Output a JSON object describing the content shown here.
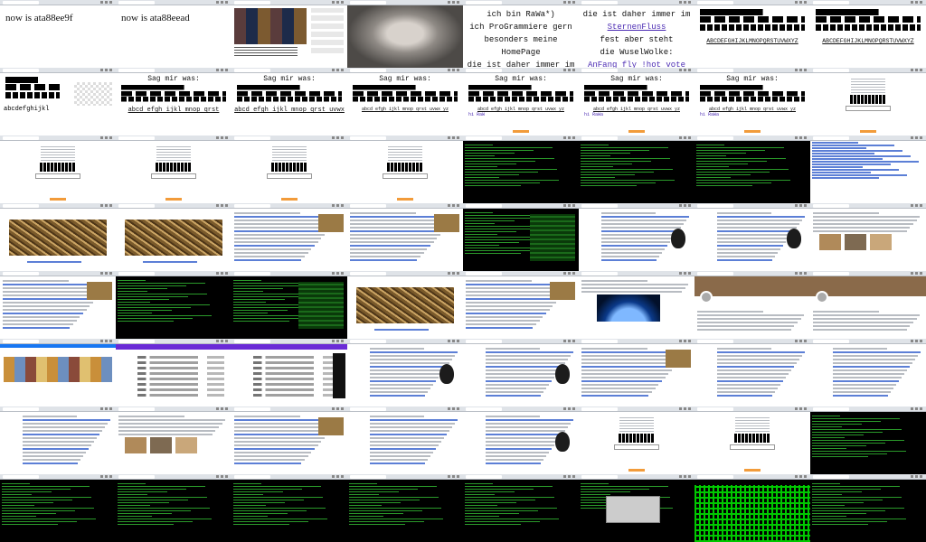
{
  "tiles": [
    {
      "kind": "text",
      "caption": "now is ata88ee9f"
    },
    {
      "kind": "text",
      "caption": "now is ata88eead"
    },
    {
      "kind": "video"
    },
    {
      "kind": "portrait"
    },
    {
      "kind": "poem1",
      "lines": [
        "ich bin RaWa*)",
        "ich ProGrammiere gern",
        "besonders meine HomePage",
        "die ist daher immer im"
      ]
    },
    {
      "kind": "poem2",
      "lines": [
        "die ist daher immer im",
        "SternenFluss",
        "fest aber steht",
        "die WuselWolke:",
        "AnFang fly !hot vote"
      ]
    },
    {
      "kind": "alpha",
      "alpha": "ABCDEFGHIJKLMNOPQRSTUVWXYZ"
    },
    {
      "kind": "alpha",
      "alpha": "ABCDEFGHIJKLMNOPQRSTUVWXYZ"
    },
    {
      "kind": "lower",
      "lower": "abcdefghijkl"
    },
    {
      "kind": "sag",
      "head": "Sag mir was:",
      "line": "abcd efgh ijkl mnop qrst"
    },
    {
      "kind": "sag",
      "head": "Sag mir was:",
      "line": "abcd efgh ijkl mnop qrst uvwx"
    },
    {
      "kind": "sag2",
      "head": "Sag mir was:",
      "line": "abcd efgh ijkl mnop qrst uvwx yz"
    },
    {
      "kind": "sag3",
      "head": "Sag mir was:",
      "line": "abcd efgh ijkl mnop qrst uvwx yz",
      "hi": "hi RaW"
    },
    {
      "kind": "sag3",
      "head": "Sag mir was:",
      "line": "abcd efgh ijkl mnop qrst uvwx yz",
      "hi": "hi RaWa"
    },
    {
      "kind": "sag3",
      "head": "Sag mir was:",
      "line": "abcd efgh ijkl mnop qrst uvwx yz",
      "hi": "hi RaWa"
    },
    {
      "kind": "form"
    },
    {
      "kind": "form"
    },
    {
      "kind": "form"
    },
    {
      "kind": "form"
    },
    {
      "kind": "form"
    },
    {
      "kind": "term"
    },
    {
      "kind": "term"
    },
    {
      "kind": "term"
    },
    {
      "kind": "links"
    },
    {
      "kind": "worms"
    },
    {
      "kind": "worms"
    },
    {
      "kind": "article"
    },
    {
      "kind": "article"
    },
    {
      "kind": "termgreen"
    },
    {
      "kind": "wikibeetle"
    },
    {
      "kind": "wikibeetle"
    },
    {
      "kind": "gallery"
    },
    {
      "kind": "article"
    },
    {
      "kind": "term"
    },
    {
      "kind": "termgreen"
    },
    {
      "kind": "worms"
    },
    {
      "kind": "article"
    },
    {
      "kind": "earth"
    },
    {
      "kind": "twitter"
    },
    {
      "kind": "twitter"
    },
    {
      "kind": "facebook"
    },
    {
      "kind": "shop"
    },
    {
      "kind": "shopdark"
    },
    {
      "kind": "wikibeetle"
    },
    {
      "kind": "wikibeetle"
    },
    {
      "kind": "article"
    },
    {
      "kind": "wiki"
    },
    {
      "kind": "wiki"
    },
    {
      "kind": "wiki"
    },
    {
      "kind": "gallery"
    },
    {
      "kind": "article"
    },
    {
      "kind": "wiki"
    },
    {
      "kind": "wikibeetle"
    },
    {
      "kind": "form"
    },
    {
      "kind": "form"
    },
    {
      "kind": "term"
    },
    {
      "kind": "term"
    },
    {
      "kind": "term"
    },
    {
      "kind": "term"
    },
    {
      "kind": "term"
    },
    {
      "kind": "term"
    },
    {
      "kind": "termpanel"
    },
    {
      "kind": "maze"
    },
    {
      "kind": "term"
    }
  ],
  "colors": {
    "link": "#4b2bb3",
    "terminal_green": "#4cff4c",
    "accent_orange": "#f29b3a"
  }
}
